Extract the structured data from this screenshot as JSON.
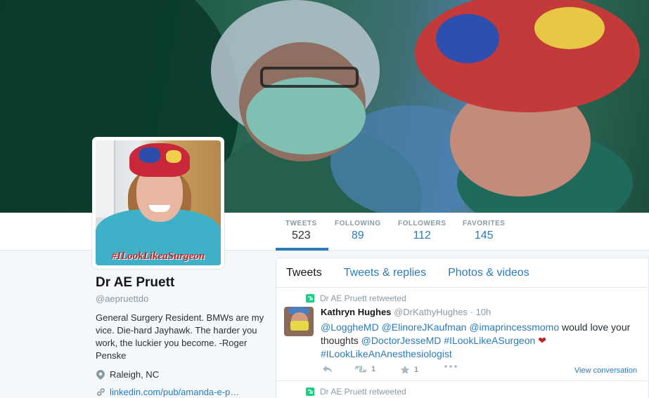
{
  "profile": {
    "name": "Dr AE Pruett",
    "handle": "@aepruettdo",
    "bio": "General Surgery Resident. BMWs are my vice. Die-hard Jayhawk. The harder you work, the luckier you become. -Roger Penske",
    "location": "Raleigh, NC",
    "website": "linkedin.com/pub/amanda-e-p…",
    "avatar_caption": "#ILookLikeaSurgeon"
  },
  "stats": {
    "tweets": {
      "label": "TWEETS",
      "value": "523"
    },
    "following": {
      "label": "FOLLOWING",
      "value": "89"
    },
    "followers": {
      "label": "FOLLOWERS",
      "value": "112"
    },
    "favorites": {
      "label": "FAVORITES",
      "value": "145"
    }
  },
  "tabs": [
    "Tweets",
    "Tweets & replies",
    "Photos & videos"
  ],
  "tweets": [
    {
      "retweet_label": "Dr AE Pruett retweeted",
      "author_name": "Kathryn Hughes",
      "author_handle": "@DrKathyHughes",
      "time": "· 10h",
      "text_parts": [
        "@LoggheMD",
        " ",
        "@ElinoreJKaufman",
        " ",
        "@imaprincessmomo",
        " would love your thoughts ",
        "@DoctorJesseMD",
        " ",
        "#ILookLikeASurgeon",
        " ",
        "❤",
        " ",
        "#ILookLikeAnAnesthesiologist"
      ],
      "retweets": "1",
      "favorites": "1",
      "view_conversation": "View conversation"
    },
    {
      "retweet_label": "Dr AE Pruett retweeted"
    }
  ],
  "colors": {
    "link": "#2b7bb9",
    "retweet_green": "#19cf86",
    "heart": "#c0262a",
    "muted": "#8899a6"
  }
}
